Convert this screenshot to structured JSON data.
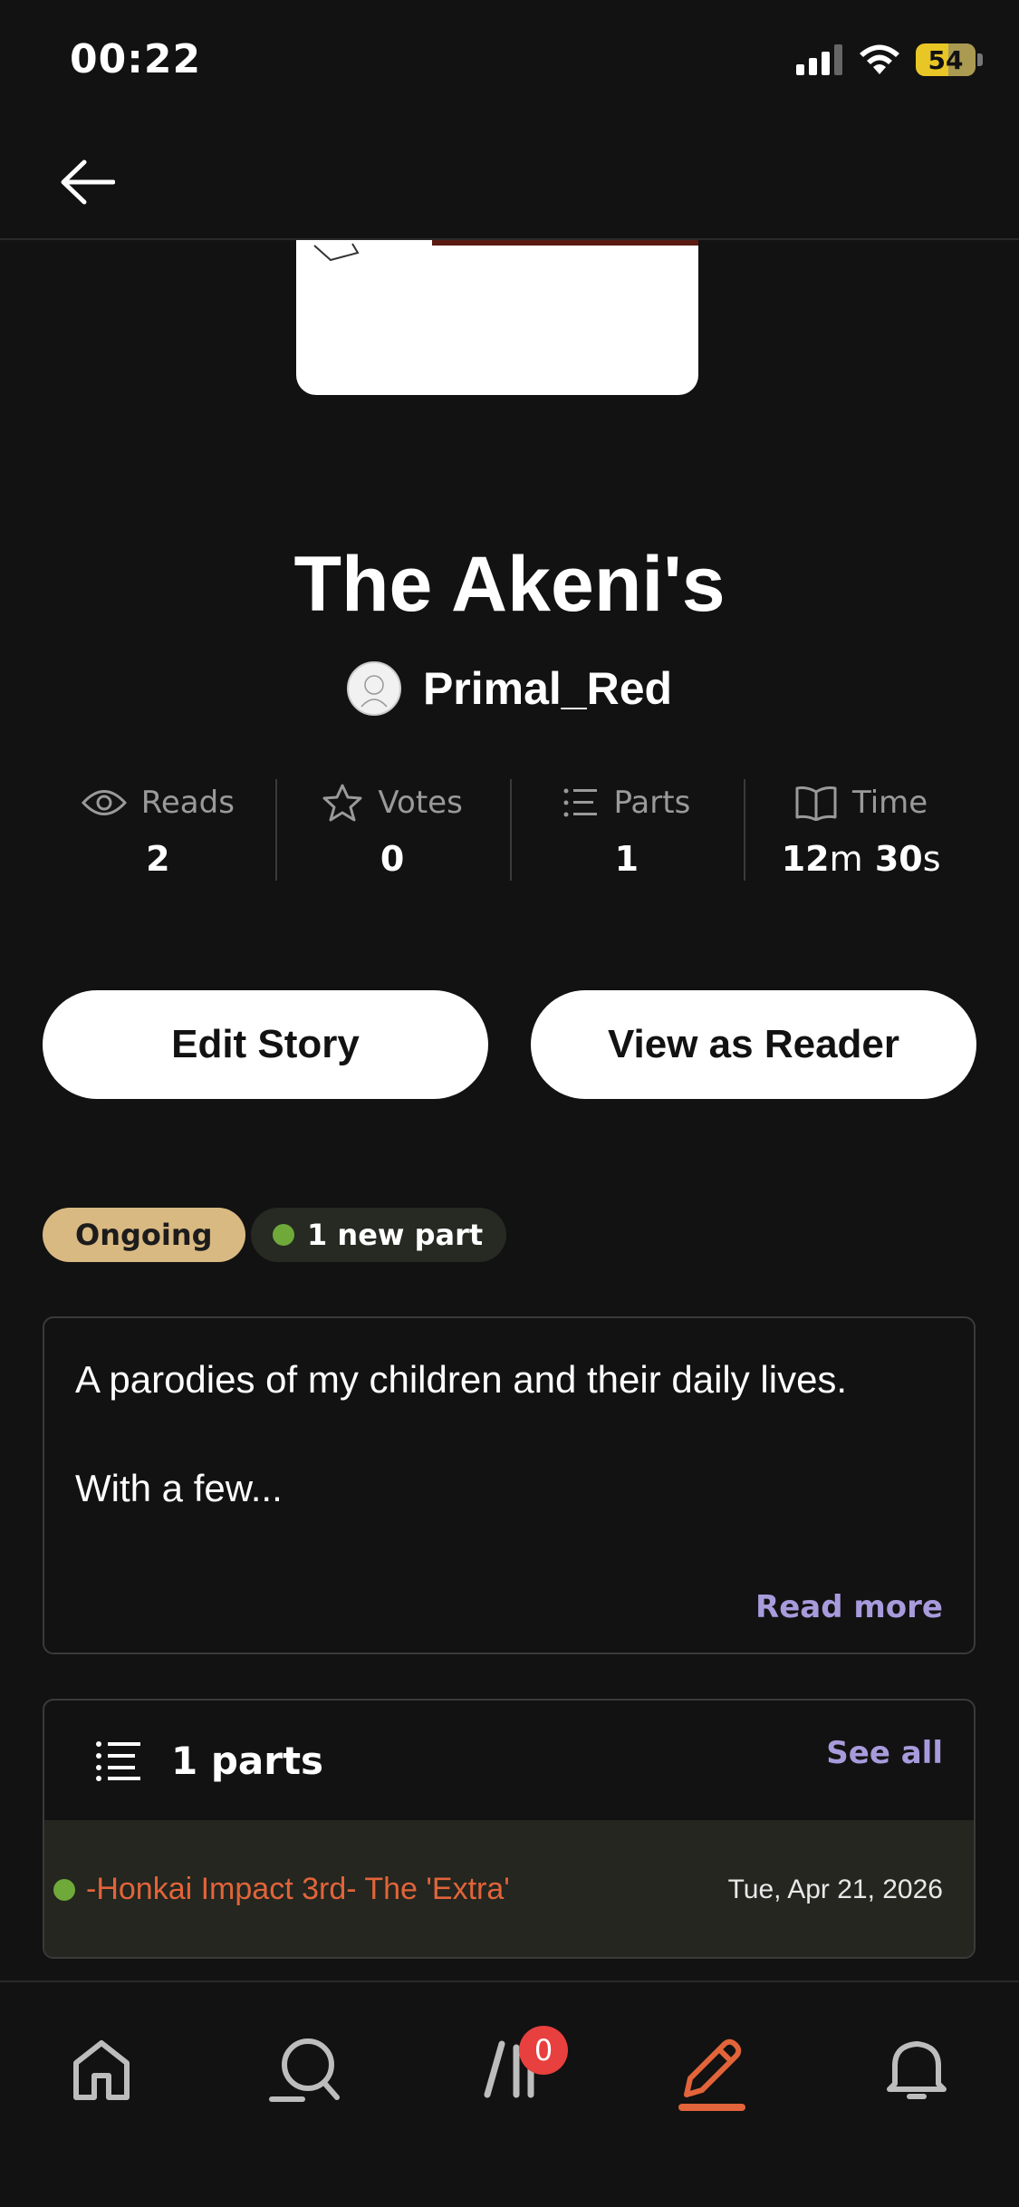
{
  "status_bar": {
    "time": "00:22",
    "battery": "54"
  },
  "story": {
    "title": "The Akeni's",
    "author": "Primal_Red"
  },
  "stats": [
    {
      "icon": "eye-icon",
      "label": "Reads",
      "value": "2"
    },
    {
      "icon": "star-icon",
      "label": "Votes",
      "value": "0"
    },
    {
      "icon": "list-icon",
      "label": "Parts",
      "value": "1"
    },
    {
      "icon": "book-icon",
      "label": "Time",
      "value_minutes": "12",
      "minutes_unit": "m",
      "value_seconds": "30",
      "seconds_unit": "s"
    }
  ],
  "actions": {
    "edit_label": "Edit Story",
    "view_label": "View as Reader"
  },
  "tags": {
    "status": "Ongoing",
    "new_parts": "1 new part"
  },
  "description": {
    "text": "A parodies of my children and their daily lives.\n\nWith a few...",
    "read_more": "Read more"
  },
  "parts": {
    "header": "1 parts",
    "see_all": "See all",
    "items": [
      {
        "title": "-Honkai Impact 3rd- The 'Extra'",
        "date": "Tue, Apr 21, 2026"
      }
    ]
  },
  "bottom_nav": {
    "items": [
      "home-icon",
      "search-icon",
      "library-icon",
      "write-icon",
      "notifications-icon"
    ],
    "library_badge": "0",
    "active": "write-icon"
  },
  "colors": {
    "accent": "#e2643a",
    "link": "#a89bdc",
    "ongoing": "#d9b982",
    "new_dot": "#6fa93a"
  }
}
